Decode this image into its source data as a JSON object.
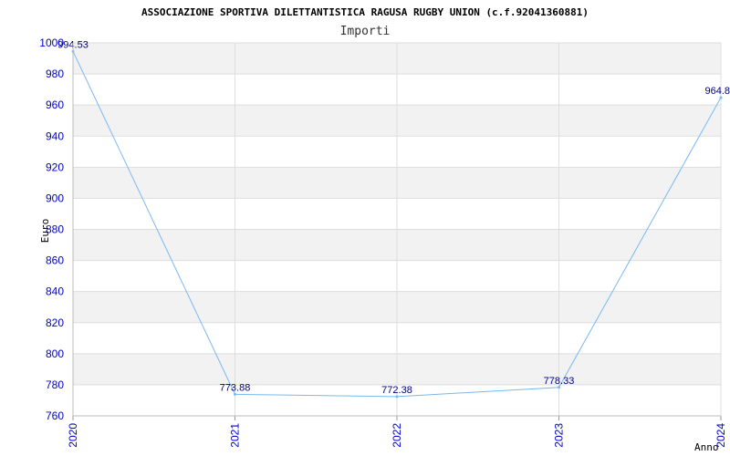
{
  "chart_data": {
    "type": "line",
    "title": "ASSOCIAZIONE SPORTIVA DILETTANTISTICA RAGUSA RUGBY UNION (c.f.92041360881)",
    "subtitle": "Importi",
    "xlabel": "Anno",
    "ylabel": "Euro",
    "categories": [
      "2020",
      "2021",
      "2022",
      "2023",
      "2024"
    ],
    "values": [
      994.53,
      773.88,
      772.38,
      778.33,
      964.8
    ],
    "data_labels": [
      "994.53",
      "773.88",
      "772.38",
      "778.33",
      "964.8"
    ],
    "ylim": [
      760,
      1000
    ],
    "yticks": [
      760,
      780,
      800,
      820,
      840,
      860,
      880,
      900,
      920,
      940,
      960,
      980,
      1000
    ],
    "grid": true,
    "colors": {
      "line": "#7ab8f0",
      "band": "#f2f2f2",
      "grid": "#dddddd",
      "tick_text": "#0000cc",
      "label_text": "#000080"
    }
  }
}
